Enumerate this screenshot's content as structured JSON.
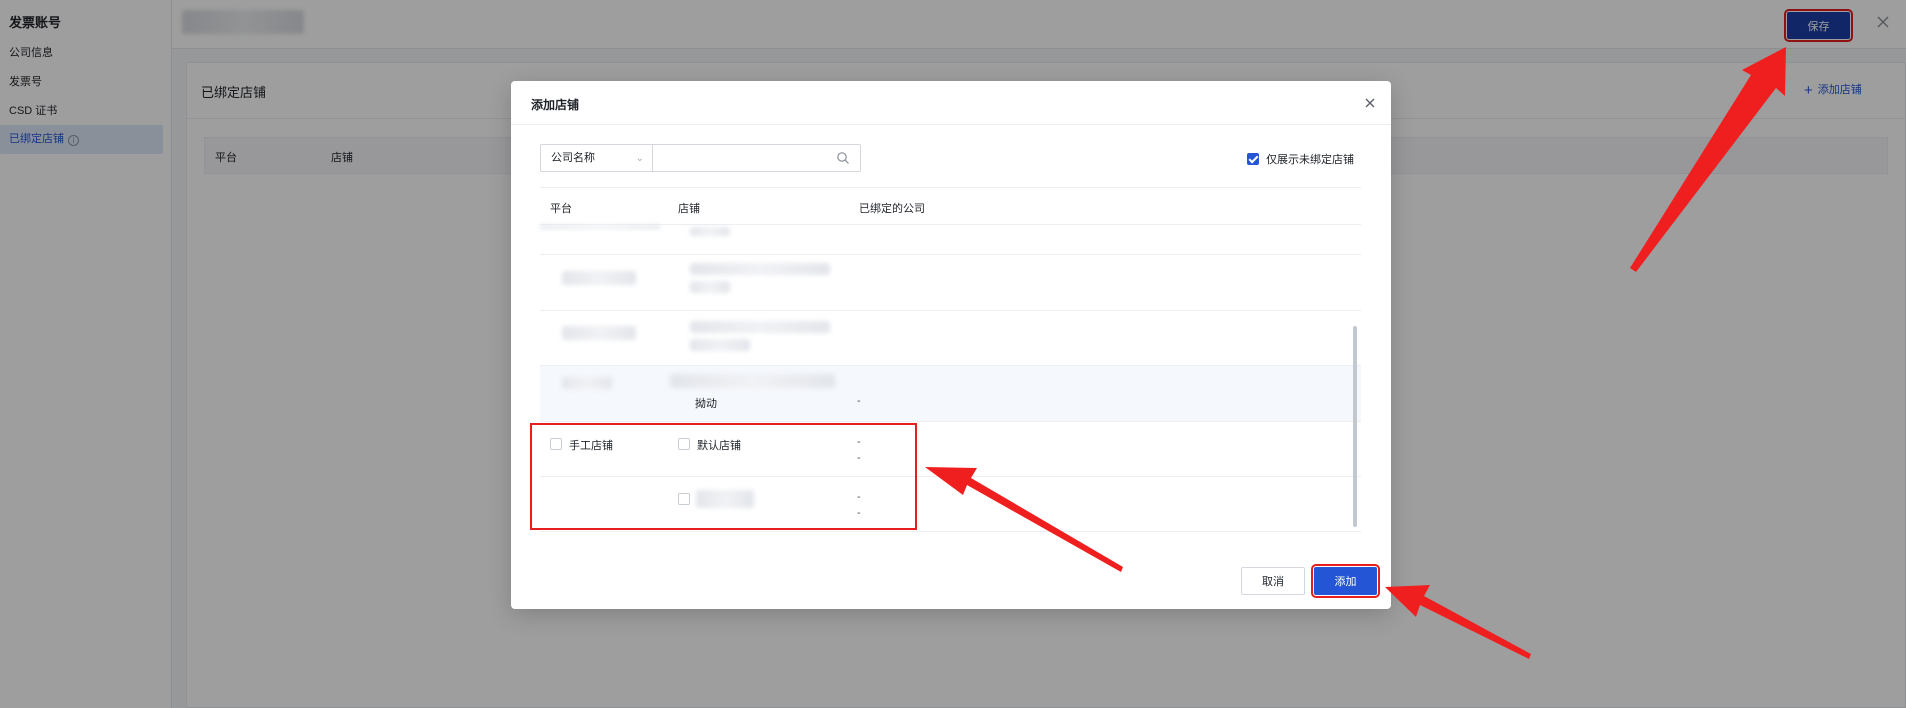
{
  "sidebar": {
    "title": "发票账号",
    "items": [
      {
        "label": "公司信息"
      },
      {
        "label": "发票号"
      },
      {
        "label": "CSD 证书"
      },
      {
        "label": "已绑定店铺",
        "active": true
      }
    ],
    "info_icon": "info-circle-icon"
  },
  "header": {
    "save_label": "保存",
    "close_icon": "close-icon"
  },
  "panel": {
    "title": "已绑定店铺",
    "add_label": "添加店铺",
    "columns": [
      "平台",
      "店铺"
    ]
  },
  "modal": {
    "title": "添加店铺",
    "filter": {
      "selected": "公司名称",
      "search_value": "",
      "search_placeholder": ""
    },
    "only_unbound_label": "仅展示未绑定店铺",
    "only_unbound_checked": true,
    "columns": [
      "平台",
      "店铺",
      "已绑定的公司"
    ],
    "rows": [
      {
        "platform": "",
        "store": "",
        "company": ""
      },
      {
        "platform": "",
        "store": "",
        "company": ""
      },
      {
        "platform": "",
        "store": "",
        "company": ""
      },
      {
        "platform": "",
        "store": "拗动",
        "company": "-"
      },
      {
        "platform": "手工店铺",
        "store": "默认店铺",
        "company": "-",
        "company2": "-"
      },
      {
        "platform": "",
        "store": "",
        "company": "-",
        "company2": "-"
      }
    ],
    "cancel_label": "取消",
    "add_label": "添加"
  },
  "colors": {
    "primary": "#2455d4",
    "save_button": "#1c3ea6",
    "annotation_red": "#e61e1e"
  }
}
